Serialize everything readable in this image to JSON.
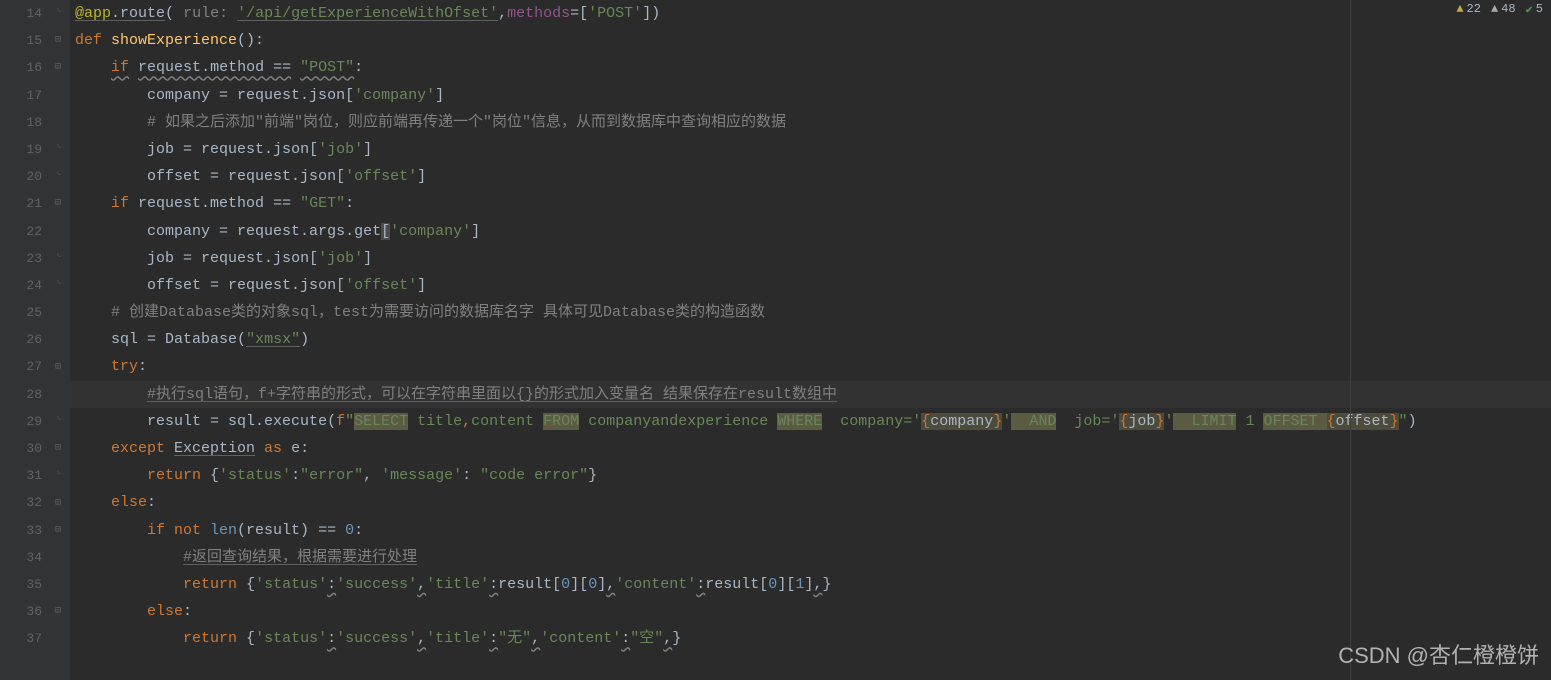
{
  "status_bar": {
    "warn1": "22",
    "warn2": "48",
    "ok": "5"
  },
  "gutter": [
    "14",
    "15",
    "16",
    "17",
    "18",
    "19",
    "20",
    "21",
    "22",
    "23",
    "24",
    "25",
    "26",
    "27",
    "28",
    "29",
    "30",
    "31",
    "32",
    "33",
    "34",
    "35",
    "36",
    "37"
  ],
  "folds": {
    "14": "end",
    "15": "minus",
    "16": "minus",
    "19": "end",
    "20": "end",
    "21": "minus",
    "23": "end",
    "24": "end",
    "27": "minus",
    "29": "end",
    "30": "minus",
    "31": "end",
    "32": "minus",
    "33": "minus",
    "36": "minus"
  },
  "watermark": "CSDN @杏仁橙橙饼",
  "code": {
    "l14": {
      "deco": "@app",
      "route": ".route",
      "open": "(",
      "hint": "rule: ",
      "url": "'/api/getExperienceWithOfset'",
      "comma": ",",
      "methods": "methods",
      "eq": "=[",
      "post": "'POST'",
      "close": "])"
    },
    "l15": {
      "def": "def ",
      "name": "showExperience",
      "paren": "():"
    },
    "l16": {
      "if_": "if",
      "sp": " ",
      "req": "request",
      "dot": ".method ",
      "eq": "==",
      "sp2": " ",
      "str": "\"POST\"",
      "colon": ":"
    },
    "l17": {
      "a": "company ",
      "eq": "=",
      "b": " request.json[",
      "s": "'company'",
      "c": "]"
    },
    "l18": "# 如果之后添加\"前端\"岗位，则应前端再传递一个\"岗位\"信息，从而到数据库中查询相应的数据",
    "l19": {
      "a": "job ",
      "eq": "=",
      "b": " request.json[",
      "s": "'job'",
      "c": "]"
    },
    "l20": {
      "a": "offset ",
      "eq": "=",
      "b": " request.json[",
      "s": "'offset'",
      "c": "]"
    },
    "l21": {
      "if_": "if",
      "a": " request.method ",
      "eq": "==",
      "sp": " ",
      "str": "\"GET\"",
      "colon": ":"
    },
    "l22": {
      "a": "company ",
      "eq": "=",
      "b": " request.args.get",
      "br": "[",
      "s": "'company'",
      "c": "]"
    },
    "l23": {
      "a": "job ",
      "eq": "=",
      "b": " request.json[",
      "s": "'job'",
      "c": "]"
    },
    "l24": {
      "a": "offset ",
      "eq": "=",
      "b": " request.json[",
      "s": "'offset'",
      "c": "]"
    },
    "l25": "# 创建Database类的对象sql，test为需要访问的数据库名字 具体可见Database类的构造函数",
    "l26": {
      "a": "sql ",
      "eq": "=",
      "b": " Database(",
      "s": "\"xmsx\"",
      "c": ")"
    },
    "l27": {
      "try_": "try",
      "colon": ":"
    },
    "l28": "#执行sql语句，f+字符串的形式，可以在字符串里面以{}的形式加入变量名 结果保存在result数组中",
    "l29": {
      "a": "result ",
      "eq": "=",
      "b": " sql.execute(",
      "f": "f",
      "q": "\"",
      "s1": "SELECT",
      "s2": " title",
      "s3": ",",
      "s4": "content ",
      "s5": "FROM",
      "s6": " companyandexperience ",
      "s7": "WHERE",
      "s8": "  company=",
      "sq": "'",
      "br1": "{",
      "v1": "company",
      "br2": "}",
      "sq2": "'",
      "s9": "  AND",
      "s10": "  job=",
      "sq3": "'",
      "br3": "{",
      "v2": "job",
      "br4": "}",
      "sq4": "'",
      "s11": "  LIMIT",
      "s12": " 1 ",
      "s13": "OFFSET ",
      "br5": "{",
      "v3": "offset",
      "br6": "}",
      "q2": "\"",
      "c": ")"
    },
    "l30": {
      "except_": "except ",
      "exc": "Exception",
      "as_": " as ",
      "e": "e",
      "colon": ":"
    },
    "l31": {
      "ret": "return ",
      "a": "{",
      "s1": "'status'",
      "c1": ":",
      "s2": "\"error\"",
      "cm": ", ",
      "s3": "'message'",
      "c2": ": ",
      "s4": "\"code error\"",
      "b": "}"
    },
    "l32": {
      "else_": "else",
      "colon": ":"
    },
    "l33": {
      "if_": "if not ",
      "len": "len",
      "a": "(result) ",
      "eq": "==",
      "sp": " ",
      "n": "0",
      "colon": ":"
    },
    "l34": "#返回查询结果，根据需要进行处理",
    "l35": {
      "ret": "return ",
      "a": "{",
      "s1": "'status'",
      "c1": ":",
      "s2": "'success'",
      "cm1": ",",
      "s3": "'title'",
      "c2": ":",
      "b1": "result[",
      "n1": "0",
      "b2": "][",
      "n2": "0",
      "b3": "]",
      "cm2": ",",
      "s4": "'content'",
      "c3": ":",
      "b4": "result[",
      "n3": "0",
      "b5": "][",
      "n4": "1",
      "b6": "]",
      "cm3": ",",
      "end": "}"
    },
    "l36": {
      "else_": "else",
      "colon": ":"
    },
    "l37": {
      "ret": "return ",
      "a": "{",
      "s1": "'status'",
      "c1": ":",
      "s2": "'success'",
      "cm1": ",",
      "s3": "'title'",
      "c2": ":",
      "s4": "\"无\"",
      "cm2": ",",
      "s5": "'content'",
      "c3": ":",
      "s6": "\"空\"",
      "cm3": ",",
      "end": "}"
    }
  }
}
